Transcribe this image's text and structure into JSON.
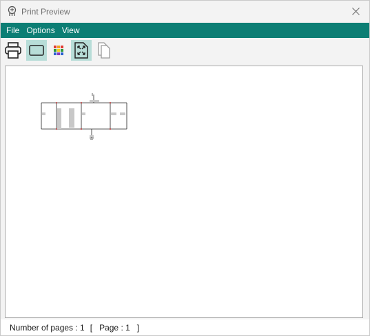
{
  "window": {
    "title": "Print Preview",
    "accent_color": "#0c7e74"
  },
  "menu": {
    "items": [
      "File",
      "Options",
      "View"
    ]
  },
  "toolbar": {
    "buttons": [
      {
        "icon": "printer-icon",
        "active": false
      },
      {
        "icon": "page-frame-icon",
        "active": true
      },
      {
        "icon": "color-grid-icon",
        "active": false
      },
      {
        "icon": "fit-page-icon",
        "active": true
      },
      {
        "icon": "multi-page-icon",
        "active": false
      }
    ]
  },
  "status": {
    "pages_label": "Number of pages : 1",
    "page_open": "[",
    "page_label": "Page : 1",
    "page_close": "]"
  }
}
